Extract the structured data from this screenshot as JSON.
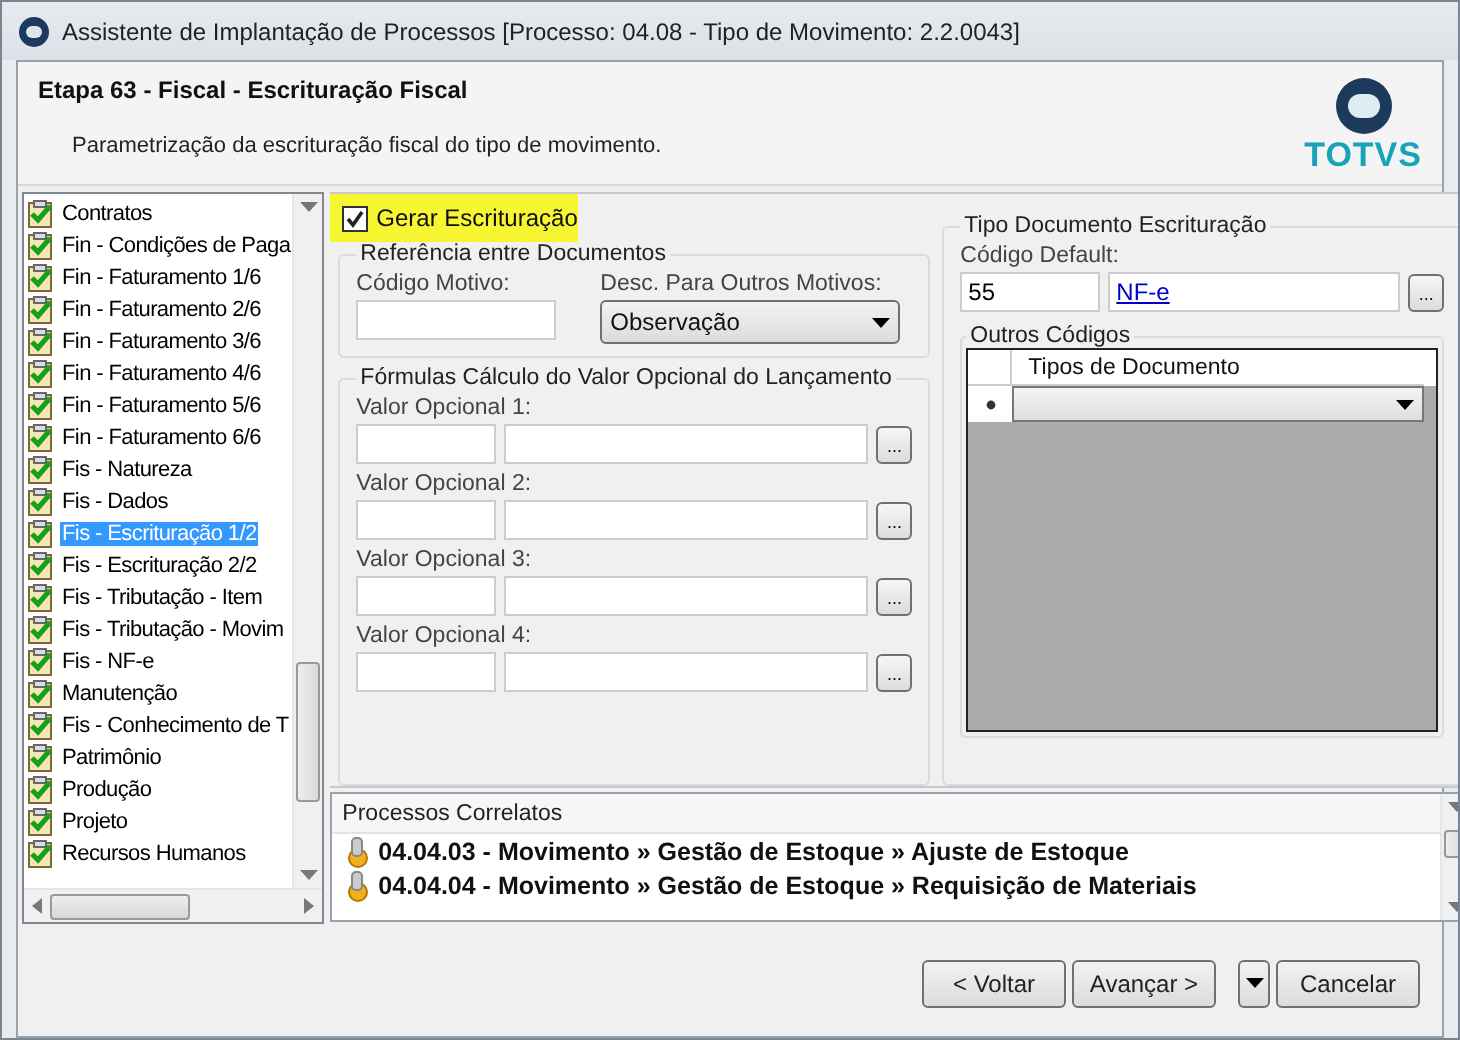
{
  "window": {
    "title": "Assistente de Implantação de Processos [Processo: 04.08 - Tipo de Movimento: 2.2.0043]"
  },
  "header": {
    "step": "Etapa 63 - Fiscal - Escrituração Fiscal",
    "description": "Parametrização da escrituração fiscal do tipo de movimento.",
    "logo": "TOTVS"
  },
  "tree": {
    "items": [
      {
        "label": "Contratos",
        "selected": false
      },
      {
        "label": "Fin - Condições de Paga",
        "selected": false
      },
      {
        "label": "Fin - Faturamento 1/6",
        "selected": false
      },
      {
        "label": "Fin - Faturamento 2/6",
        "selected": false
      },
      {
        "label": "Fin - Faturamento 3/6",
        "selected": false
      },
      {
        "label": "Fin - Faturamento 4/6",
        "selected": false
      },
      {
        "label": "Fin - Faturamento 5/6",
        "selected": false
      },
      {
        "label": "Fin - Faturamento 6/6",
        "selected": false
      },
      {
        "label": "Fis - Natureza",
        "selected": false
      },
      {
        "label": "Fis - Dados",
        "selected": false
      },
      {
        "label": "Fis - Escrituração 1/2",
        "selected": true
      },
      {
        "label": "Fis - Escrituração 2/2",
        "selected": false
      },
      {
        "label": "Fis - Tributação - Item",
        "selected": false
      },
      {
        "label": "Fis - Tributação - Movim",
        "selected": false
      },
      {
        "label": "Fis - NF-e",
        "selected": false
      },
      {
        "label": "Manutenção",
        "selected": false
      },
      {
        "label": "Fis - Conhecimento de T",
        "selected": false
      },
      {
        "label": "Patrimônio",
        "selected": false
      },
      {
        "label": "Produção",
        "selected": false
      },
      {
        "label": "Projeto",
        "selected": false
      },
      {
        "label": "Recursos Humanos",
        "selected": false
      }
    ]
  },
  "generate": {
    "label": "Gerar Escrituração",
    "checked": true
  },
  "reference": {
    "title": "Referência entre Documentos",
    "code_label": "Código Motivo:",
    "desc_label": "Desc. Para Outros Motivos:",
    "desc_value": "Observação"
  },
  "formulas": {
    "title": "Fórmulas Cálculo do Valor Opcional do Lançamento",
    "items": [
      {
        "label": "Valor Opcional 1:",
        "button": "..."
      },
      {
        "label": "Valor Opcional 2:",
        "button": "..."
      },
      {
        "label": "Valor Opcional 3:",
        "button": "..."
      },
      {
        "label": "Valor Opcional 4:",
        "button": "..."
      }
    ]
  },
  "doc_type": {
    "title": "Tipo Documento Escrituração",
    "default_label": "Código Default:",
    "code": "55",
    "name": "NF-e",
    "button": "...",
    "other_title": "Outros Códigos",
    "grid_column": "Tipos de Documento"
  },
  "related": {
    "title": "Processos Correlatos",
    "items": [
      "04.04.03 - Movimento » Gestão de Estoque » Ajuste de Estoque",
      "04.04.04 - Movimento » Gestão de Estoque » Requisição de Materiais"
    ]
  },
  "buttons": [
    {
      "label": "< Voltar",
      "kind": "nav"
    },
    {
      "label": "Avançar >",
      "kind": "nav"
    },
    {
      "label": "Cancelar",
      "kind": "split"
    }
  ]
}
